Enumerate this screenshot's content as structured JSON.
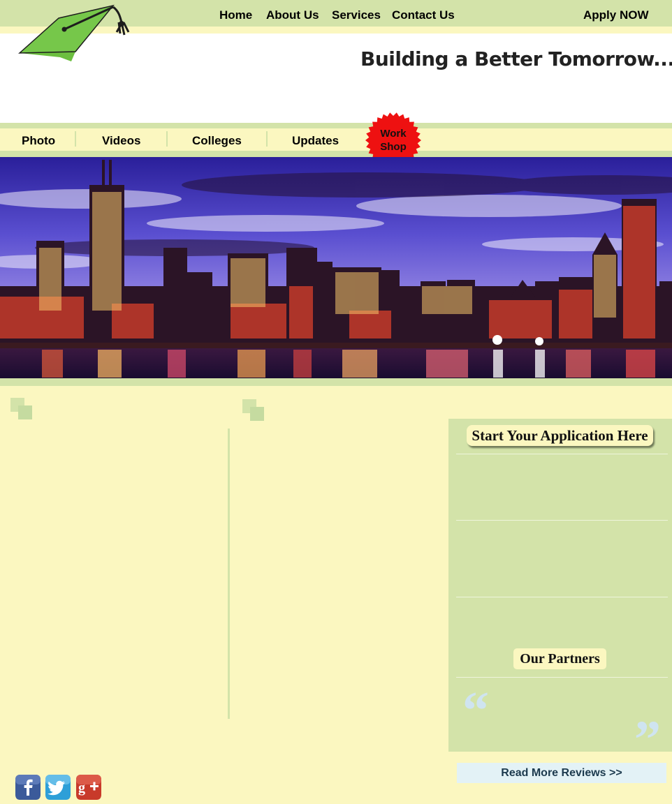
{
  "top_nav": {
    "home": "Home",
    "about": "About Us",
    "services": "Services",
    "contact": "Contact Us",
    "apply": "Apply NOW"
  },
  "header": {
    "tagline": "Building a Better Tomorrow....",
    "logo_icon": "graduation-cap-icon"
  },
  "sub_nav": {
    "photo": "Photo",
    "videos": "Videos",
    "colleges": "Colleges",
    "updates": "Updates",
    "workshop_line1": "Work",
    "workshop_line2": "Shop"
  },
  "hero": {
    "image": "city-skyline-night"
  },
  "sidebar": {
    "application_title": "Start Your Application Here",
    "partners_title": "Our Partners",
    "open_quote": "“",
    "close_quote": "”",
    "read_more": "Read More Reviews >>"
  },
  "social": [
    "facebook-icon",
    "twitter-icon",
    "google-plus-icon"
  ],
  "colors": {
    "green": "#d3e3a9",
    "cream": "#fbf7c0",
    "workshop_red": "#ee1111",
    "logo_green": "#6cbf3f"
  }
}
